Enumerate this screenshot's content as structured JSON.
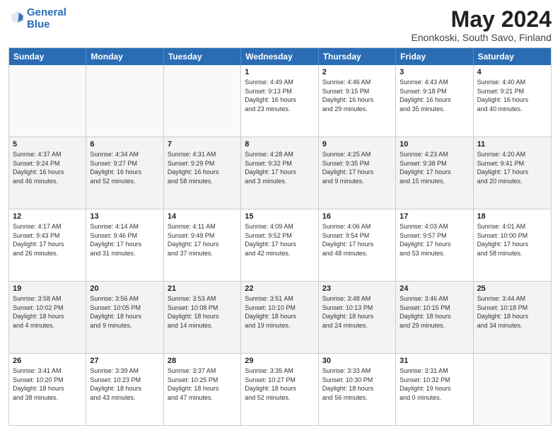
{
  "header": {
    "logo_line1": "General",
    "logo_line2": "Blue",
    "title": "May 2024",
    "subtitle": "Enonkoski, South Savo, Finland"
  },
  "days_of_week": [
    "Sunday",
    "Monday",
    "Tuesday",
    "Wednesday",
    "Thursday",
    "Friday",
    "Saturday"
  ],
  "weeks": [
    [
      {
        "day": "",
        "info": ""
      },
      {
        "day": "",
        "info": ""
      },
      {
        "day": "",
        "info": ""
      },
      {
        "day": "1",
        "info": "Sunrise: 4:49 AM\nSunset: 9:13 PM\nDaylight: 16 hours\nand 23 minutes."
      },
      {
        "day": "2",
        "info": "Sunrise: 4:46 AM\nSunset: 9:15 PM\nDaylight: 16 hours\nand 29 minutes."
      },
      {
        "day": "3",
        "info": "Sunrise: 4:43 AM\nSunset: 9:18 PM\nDaylight: 16 hours\nand 35 minutes."
      },
      {
        "day": "4",
        "info": "Sunrise: 4:40 AM\nSunset: 9:21 PM\nDaylight: 16 hours\nand 40 minutes."
      }
    ],
    [
      {
        "day": "5",
        "info": "Sunrise: 4:37 AM\nSunset: 9:24 PM\nDaylight: 16 hours\nand 46 minutes."
      },
      {
        "day": "6",
        "info": "Sunrise: 4:34 AM\nSunset: 9:27 PM\nDaylight: 16 hours\nand 52 minutes."
      },
      {
        "day": "7",
        "info": "Sunrise: 4:31 AM\nSunset: 9:29 PM\nDaylight: 16 hours\nand 58 minutes."
      },
      {
        "day": "8",
        "info": "Sunrise: 4:28 AM\nSunset: 9:32 PM\nDaylight: 17 hours\nand 3 minutes."
      },
      {
        "day": "9",
        "info": "Sunrise: 4:25 AM\nSunset: 9:35 PM\nDaylight: 17 hours\nand 9 minutes."
      },
      {
        "day": "10",
        "info": "Sunrise: 4:23 AM\nSunset: 9:38 PM\nDaylight: 17 hours\nand 15 minutes."
      },
      {
        "day": "11",
        "info": "Sunrise: 4:20 AM\nSunset: 9:41 PM\nDaylight: 17 hours\nand 20 minutes."
      }
    ],
    [
      {
        "day": "12",
        "info": "Sunrise: 4:17 AM\nSunset: 9:43 PM\nDaylight: 17 hours\nand 26 minutes."
      },
      {
        "day": "13",
        "info": "Sunrise: 4:14 AM\nSunset: 9:46 PM\nDaylight: 17 hours\nand 31 minutes."
      },
      {
        "day": "14",
        "info": "Sunrise: 4:11 AM\nSunset: 9:49 PM\nDaylight: 17 hours\nand 37 minutes."
      },
      {
        "day": "15",
        "info": "Sunrise: 4:09 AM\nSunset: 9:52 PM\nDaylight: 17 hours\nand 42 minutes."
      },
      {
        "day": "16",
        "info": "Sunrise: 4:06 AM\nSunset: 9:54 PM\nDaylight: 17 hours\nand 48 minutes."
      },
      {
        "day": "17",
        "info": "Sunrise: 4:03 AM\nSunset: 9:57 PM\nDaylight: 17 hours\nand 53 minutes."
      },
      {
        "day": "18",
        "info": "Sunrise: 4:01 AM\nSunset: 10:00 PM\nDaylight: 17 hours\nand 58 minutes."
      }
    ],
    [
      {
        "day": "19",
        "info": "Sunrise: 3:58 AM\nSunset: 10:02 PM\nDaylight: 18 hours\nand 4 minutes."
      },
      {
        "day": "20",
        "info": "Sunrise: 3:56 AM\nSunset: 10:05 PM\nDaylight: 18 hours\nand 9 minutes."
      },
      {
        "day": "21",
        "info": "Sunrise: 3:53 AM\nSunset: 10:08 PM\nDaylight: 18 hours\nand 14 minutes."
      },
      {
        "day": "22",
        "info": "Sunrise: 3:51 AM\nSunset: 10:10 PM\nDaylight: 18 hours\nand 19 minutes."
      },
      {
        "day": "23",
        "info": "Sunrise: 3:48 AM\nSunset: 10:13 PM\nDaylight: 18 hours\nand 24 minutes."
      },
      {
        "day": "24",
        "info": "Sunrise: 3:46 AM\nSunset: 10:15 PM\nDaylight: 18 hours\nand 29 minutes."
      },
      {
        "day": "25",
        "info": "Sunrise: 3:44 AM\nSunset: 10:18 PM\nDaylight: 18 hours\nand 34 minutes."
      }
    ],
    [
      {
        "day": "26",
        "info": "Sunrise: 3:41 AM\nSunset: 10:20 PM\nDaylight: 18 hours\nand 38 minutes."
      },
      {
        "day": "27",
        "info": "Sunrise: 3:39 AM\nSunset: 10:23 PM\nDaylight: 18 hours\nand 43 minutes."
      },
      {
        "day": "28",
        "info": "Sunrise: 3:37 AM\nSunset: 10:25 PM\nDaylight: 18 hours\nand 47 minutes."
      },
      {
        "day": "29",
        "info": "Sunrise: 3:35 AM\nSunset: 10:27 PM\nDaylight: 18 hours\nand 52 minutes."
      },
      {
        "day": "30",
        "info": "Sunrise: 3:33 AM\nSunset: 10:30 PM\nDaylight: 18 hours\nand 56 minutes."
      },
      {
        "day": "31",
        "info": "Sunrise: 3:31 AM\nSunset: 10:32 PM\nDaylight: 19 hours\nand 0 minutes."
      },
      {
        "day": "",
        "info": ""
      }
    ]
  ]
}
